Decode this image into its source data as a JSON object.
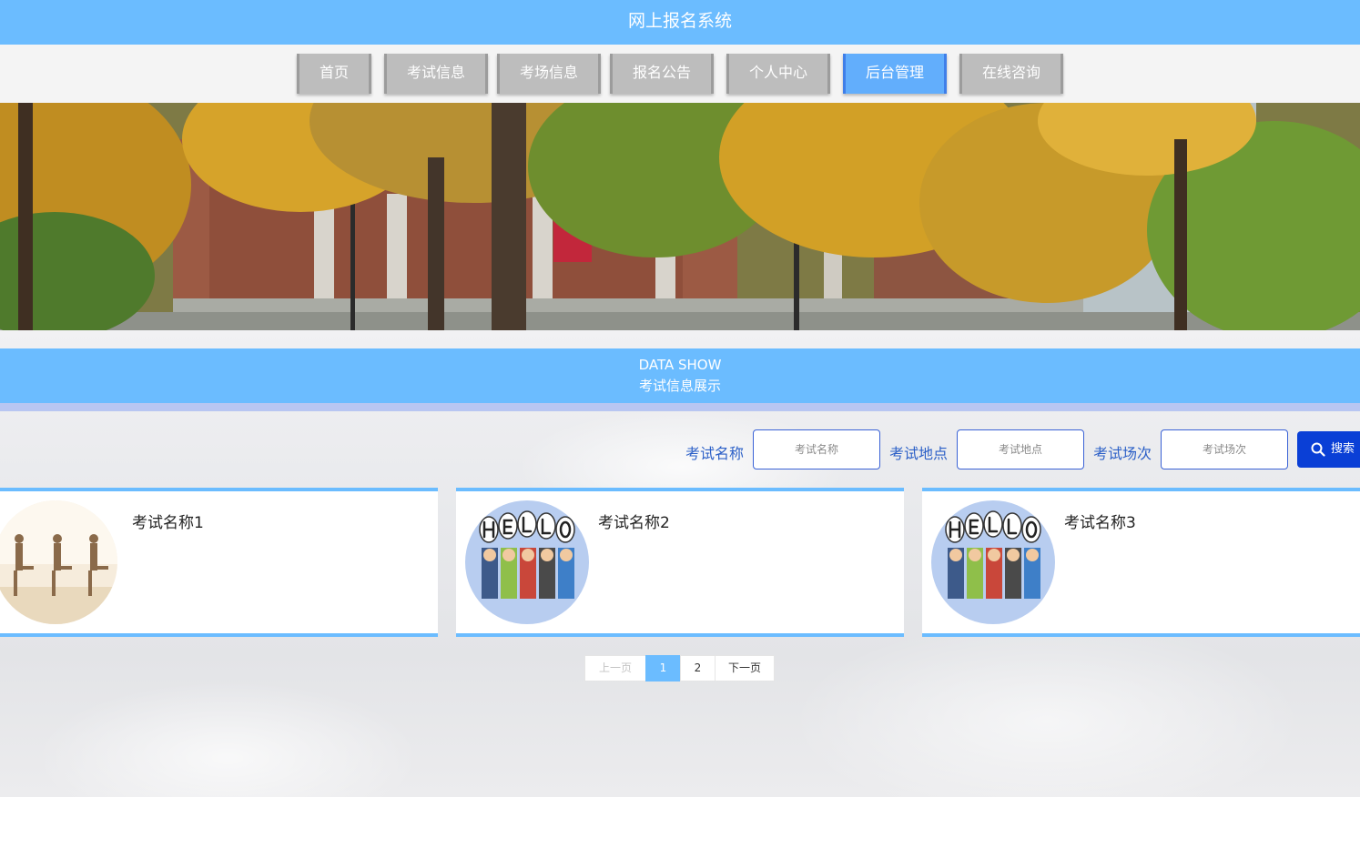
{
  "header": {
    "title": "网上报名系统"
  },
  "nav": {
    "items": [
      {
        "label": "首页"
      },
      {
        "label": "考试信息"
      },
      {
        "label": "考场信息"
      },
      {
        "label": "报名公告"
      },
      {
        "label": "个人中心"
      },
      {
        "label": "后台管理",
        "active": true
      },
      {
        "label": "在线咨询"
      }
    ]
  },
  "section": {
    "title_en": "DATA SHOW",
    "title_zh": "考试信息展示"
  },
  "search": {
    "fields": [
      {
        "label": "考试名称",
        "placeholder": "考试名称"
      },
      {
        "label": "考试地点",
        "placeholder": "考试地点"
      },
      {
        "label": "考试场次",
        "placeholder": "考试场次"
      }
    ],
    "button_label": "搜索",
    "button_icon": "search-icon"
  },
  "cards": [
    {
      "title": "考试名称1",
      "image": "dancers-photo"
    },
    {
      "title": "考试名称2",
      "image": "hello-cartoon"
    },
    {
      "title": "考试名称3",
      "image": "hello-cartoon"
    }
  ],
  "pagination": {
    "prev": "上一页",
    "pages": [
      "1",
      "2"
    ],
    "current": "1",
    "next": "下一页"
  },
  "colors": {
    "primary": "#6bbcff",
    "search_button": "#0a3fd6",
    "label": "#2b5fc7",
    "nav_button": "#bdbdbd"
  }
}
